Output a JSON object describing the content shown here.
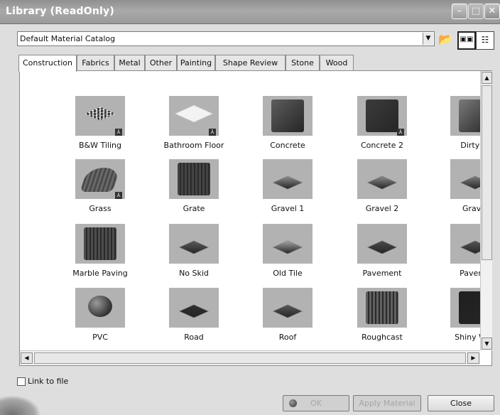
{
  "window": {
    "title": "Library (ReadOnly)",
    "min_glyph": "–",
    "max_glyph": "□",
    "close_glyph": "✕"
  },
  "catalog": {
    "selected": "Default Material Catalog",
    "arrow": "▼",
    "open_icon": "📂",
    "icons_view_icon": "▣▣",
    "list_view_icon": "☷"
  },
  "tabs": [
    {
      "label": "Construction",
      "active": true
    },
    {
      "label": "Fabrics"
    },
    {
      "label": "Metal"
    },
    {
      "label": "Other"
    },
    {
      "label": "Painting"
    },
    {
      "label": "Shape Review"
    },
    {
      "label": "Stone"
    },
    {
      "label": "Wood"
    }
  ],
  "materials": [
    {
      "label": "B&W Tiling",
      "shape": "checker",
      "linked": true
    },
    {
      "label": "Bathroom Floor",
      "shape": "bath",
      "linked": true
    },
    {
      "label": "Concrete",
      "shape": "cube",
      "color": "#5d5d5d"
    },
    {
      "label": "Concrete 2",
      "shape": "cube",
      "color": "#3b3b3b",
      "linked": true
    },
    {
      "label": "Dirty W",
      "shape": "cube",
      "color": "#7a7a7a"
    },
    {
      "label": "Grass",
      "shape": "curve",
      "linked": true
    },
    {
      "label": "Grate",
      "shape": "cube",
      "color": "#444444",
      "striped": true
    },
    {
      "label": "Gravel 1",
      "shape": "tile",
      "color": "#8d8d8d"
    },
    {
      "label": "Gravel 2",
      "shape": "tile",
      "color": "#8a8a8a"
    },
    {
      "label": "Gravel",
      "shape": "tile",
      "color": "#7f7f7f"
    },
    {
      "label": "Marble Paving",
      "shape": "cube",
      "color": "#4d4d4d",
      "striped": true
    },
    {
      "label": "No Skid",
      "shape": "tile",
      "color": "#5a5a5a"
    },
    {
      "label": "Old Tile",
      "shape": "tile",
      "color": "#a3a3a3"
    },
    {
      "label": "Pavement",
      "shape": "tile",
      "color": "#4a4a4a"
    },
    {
      "label": "Paveme",
      "shape": "tile",
      "color": "#555555"
    },
    {
      "label": "PVC",
      "shape": "sphere"
    },
    {
      "label": "Road",
      "shape": "tile",
      "color": "#2f2f2f"
    },
    {
      "label": "Roof",
      "shape": "tile",
      "color": "#575757"
    },
    {
      "label": "Roughcast",
      "shape": "cube",
      "color": "#606060",
      "striped": true
    },
    {
      "label": "Shiny Woo",
      "shape": "cube",
      "color": "#1f1f1f"
    }
  ],
  "link_to_file": {
    "label": "Link to file",
    "checked": false
  },
  "buttons": {
    "ok": "OK",
    "apply": "Apply Material",
    "close": "Close"
  },
  "scroll": {
    "up": "▲",
    "down": "▼",
    "left": "◀",
    "right": "▶"
  },
  "linked_badge": "⅄"
}
